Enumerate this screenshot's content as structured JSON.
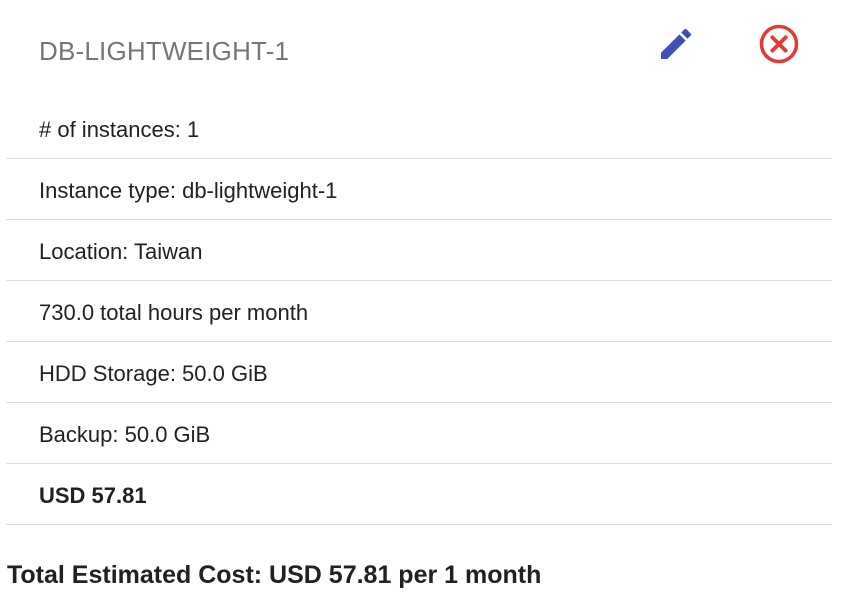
{
  "header": {
    "title": "DB-LIGHTWEIGHT-1",
    "edit_icon": "pencil-icon",
    "remove_icon": "close-circle-icon"
  },
  "colors": {
    "edit_icon": "#3f51b5",
    "remove_icon": "#e53935",
    "title_text": "#757575",
    "divider": "#dcdcdc"
  },
  "details": [
    "# of instances: 1",
    "Instance type: db-lightweight-1",
    "Location: Taiwan",
    "730.0 total hours per month",
    "HDD Storage: 50.0 GiB",
    "Backup: 50.0 GiB"
  ],
  "price": "USD 57.81",
  "total": "Total Estimated Cost: USD 57.81 per 1 month"
}
